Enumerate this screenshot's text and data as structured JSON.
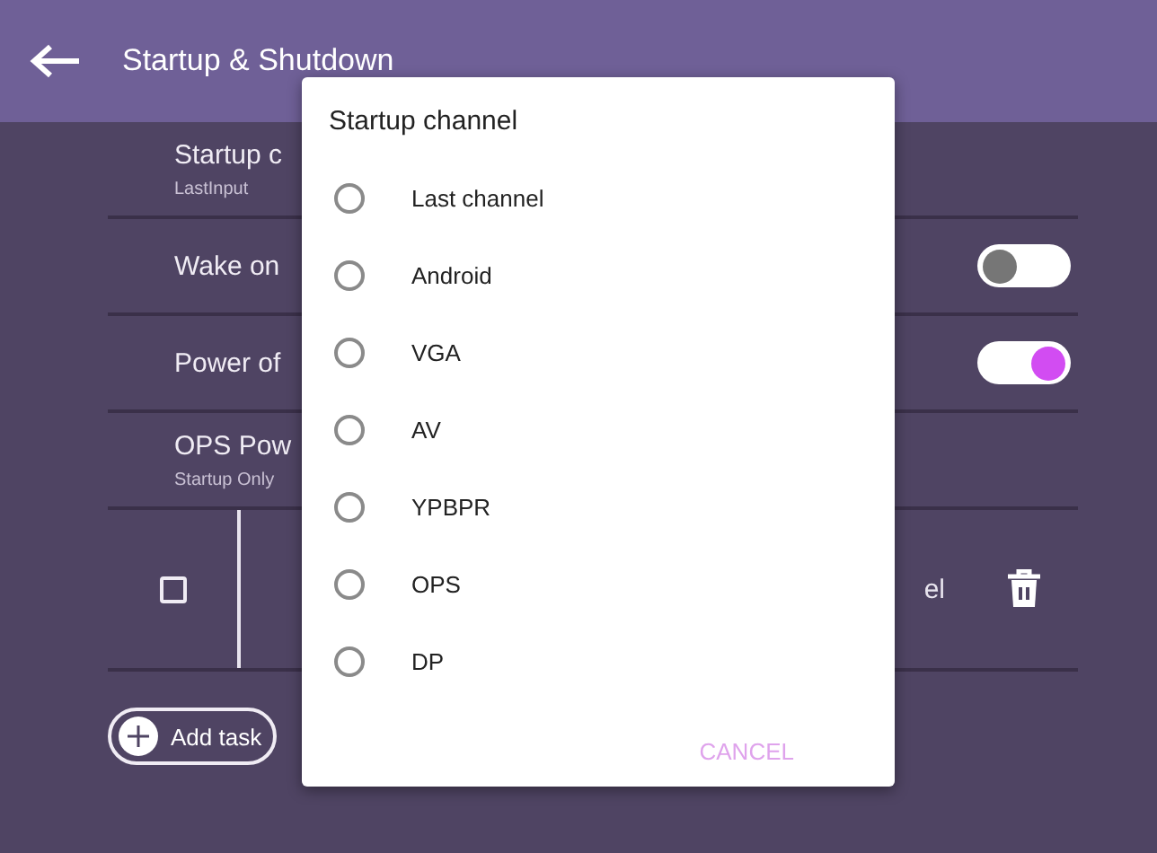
{
  "header": {
    "title": "Startup & Shutdown"
  },
  "settings": [
    {
      "kind": "value",
      "label": "Startup c",
      "value": "LastInput"
    },
    {
      "kind": "toggle",
      "label": "Wake on",
      "on": false
    },
    {
      "kind": "toggle",
      "label": "Power of",
      "on": true
    },
    {
      "kind": "value",
      "label": "OPS Pow",
      "value": "Startup Only"
    }
  ],
  "task": {
    "checked": false,
    "label": "el"
  },
  "add_task": {
    "label": "Add task"
  },
  "dialog": {
    "title": "Startup channel",
    "options": [
      {
        "label": "Last channel",
        "selected": false
      },
      {
        "label": "Android",
        "selected": false
      },
      {
        "label": "VGA",
        "selected": false
      },
      {
        "label": "AV",
        "selected": false
      },
      {
        "label": "YPBPR",
        "selected": false
      },
      {
        "label": "OPS",
        "selected": false
      },
      {
        "label": "DP",
        "selected": false
      }
    ],
    "cancel": "CANCEL"
  }
}
